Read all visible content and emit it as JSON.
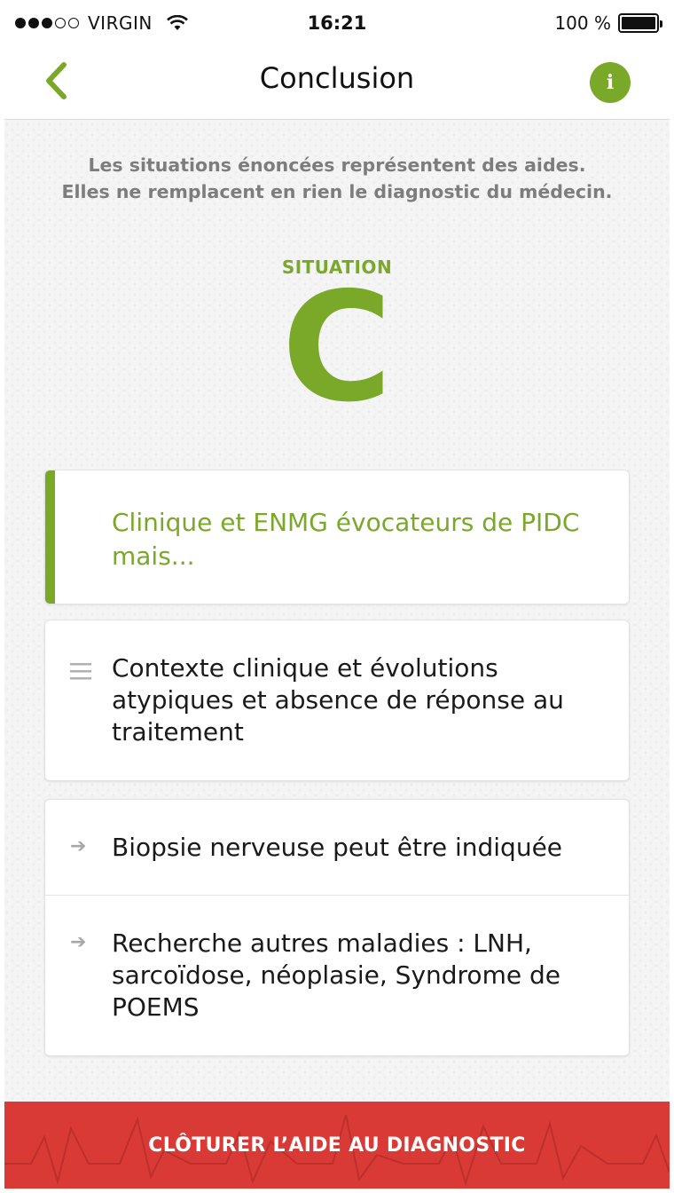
{
  "status_bar": {
    "carrier": "VIRGIN",
    "time": "16:21",
    "battery": "100 %"
  },
  "nav": {
    "title": "Conclusion",
    "info_label": "i"
  },
  "disclaimer": {
    "line1": "Les situations énoncées représentent des aides.",
    "line2": "Elles ne remplacent en rien le diagnostic du médecin."
  },
  "situation": {
    "label": "SITUATION",
    "letter": "C"
  },
  "cards": {
    "heading": "Clinique et ENMG évocateurs de PIDC mais...",
    "context": "Contexte clinique et évolutions atypiques et absence de réponse au traitement",
    "actions": [
      "Biopsie nerveuse peut être indiquée",
      "Recherche autres maladies : LNH, sarcoïdose, néoplasie, Syndrome de POEMS"
    ]
  },
  "footer": {
    "close_label": "CLÔTURER L’AIDE AU DIAGNOSTIC"
  },
  "colors": {
    "accent_green": "#7aa829",
    "footer_red": "#d93a35",
    "muted_text": "#7d7d7d"
  }
}
